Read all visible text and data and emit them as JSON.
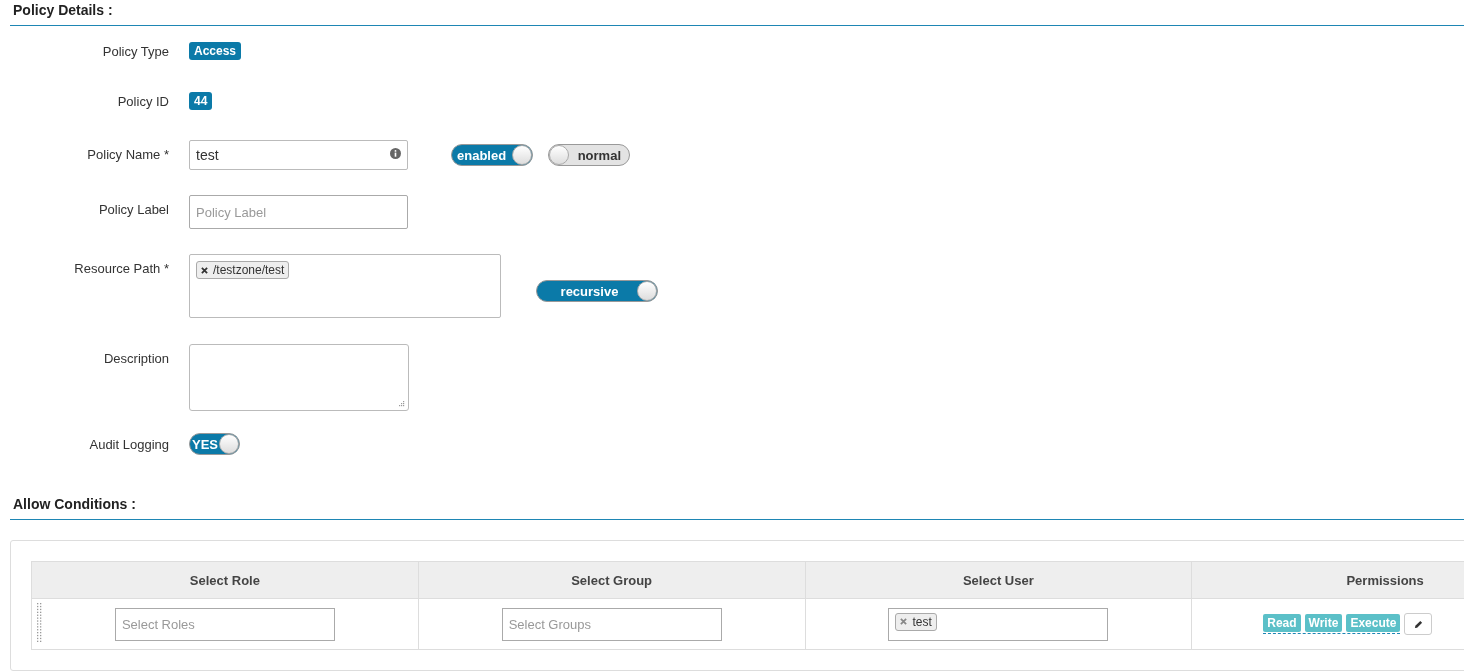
{
  "policy_details": {
    "title": "Policy Details :",
    "fields": [
      {
        "kind": "badge",
        "label": "Policy Type",
        "value": "Access"
      },
      {
        "kind": "badge",
        "label": "Policy ID",
        "value": "44"
      },
      {
        "kind": "input",
        "label": "Policy Name *",
        "value": "test",
        "info": true,
        "toggles": [
          {
            "label": "enabled",
            "on": true
          },
          {
            "label": "normal",
            "on": false
          }
        ]
      },
      {
        "kind": "input",
        "label": "Policy Label",
        "placeholder": "Policy Label"
      },
      {
        "kind": "tags",
        "label": "Resource Path *",
        "tags": [
          "/testzone/test"
        ],
        "toggles": [
          {
            "label": "recursive",
            "on": true
          }
        ]
      },
      {
        "kind": "textarea",
        "label": "Description"
      },
      {
        "kind": "switch",
        "label": "Audit Logging",
        "toggles": [
          {
            "label": "YES",
            "on": true
          }
        ]
      }
    ]
  },
  "allow_conditions": {
    "title": "Allow Conditions :",
    "columns": [
      "Select Role",
      "Select Group",
      "Select User",
      "Permissions"
    ],
    "rows": [
      {
        "roles_placeholder": "Select Roles",
        "groups_placeholder": "Select Groups",
        "users": [
          "test"
        ],
        "permissions": [
          "Read",
          "Write",
          "Execute"
        ]
      }
    ]
  }
}
